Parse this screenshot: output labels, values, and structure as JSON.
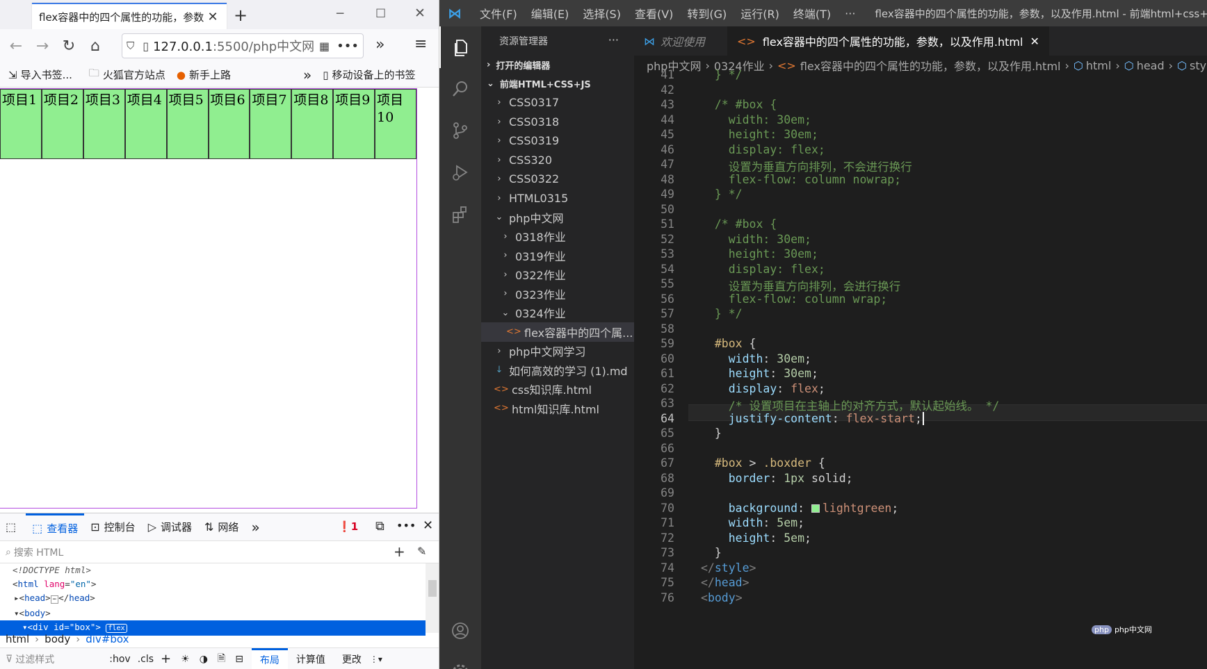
{
  "firefox": {
    "tab_title": "flex容器中的四个属性的功能，参数",
    "url_host": "127.0.0.1",
    "url_rest": ":5500/php中文网",
    "bookmarks": [
      "导入书签...",
      "火狐官方站点",
      "新手上路"
    ],
    "mobile_bookmarks": "移动设备上的书签",
    "items": [
      "项目1",
      "项目2",
      "项目3",
      "项目4",
      "项目5",
      "项目6",
      "项目7",
      "项目8",
      "项目9",
      "项目10"
    ],
    "devtools": {
      "tabs": [
        "查看器",
        "控制台",
        "调试器",
        "网络"
      ],
      "error_count": "1",
      "search_placeholder": "搜索 HTML",
      "tree": {
        "doctype": "<!DOCTYPE html>",
        "html_open": "html",
        "lang_attr": "lang",
        "lang_val": "\"en\"",
        "head": "head",
        "body": "body",
        "div_line": "<div id=\"box\">",
        "flex_badge": "flex"
      },
      "crumbs": [
        "html",
        "body",
        "div#box"
      ],
      "filter_placeholder": "过滤样式",
      "rules_tools": [
        ":hov",
        ".cls"
      ],
      "side_tabs": [
        "布局",
        "计算值",
        "更改"
      ]
    }
  },
  "vscode": {
    "menus": [
      "文件(F)",
      "编辑(E)",
      "选择(S)",
      "查看(V)",
      "转到(G)",
      "运行(R)",
      "终端(T)",
      "···"
    ],
    "window_title": "flex容器中的四个属性的功能，参数，以及作用.html - 前端html+css+js - Visu",
    "explorer_title": "资源管理器",
    "open_editors": "打开的编辑器",
    "workspace": "前端HTML+CSS+JS",
    "tree": [
      {
        "label": "CSS0317",
        "depth": 1,
        "chev": "›"
      },
      {
        "label": "CSS0318",
        "depth": 1,
        "chev": "›"
      },
      {
        "label": "CSS0319",
        "depth": 1,
        "chev": "›"
      },
      {
        "label": "CSS320",
        "depth": 1,
        "chev": "›"
      },
      {
        "label": "CSS0322",
        "depth": 1,
        "chev": "›"
      },
      {
        "label": "HTML0315",
        "depth": 1,
        "chev": "›"
      },
      {
        "label": "php中文网",
        "depth": 1,
        "chev": "⌄"
      },
      {
        "label": "0318作业",
        "depth": 2,
        "chev": "›"
      },
      {
        "label": "0319作业",
        "depth": 2,
        "chev": "›"
      },
      {
        "label": "0322作业",
        "depth": 2,
        "chev": "›"
      },
      {
        "label": "0323作业",
        "depth": 2,
        "chev": "›"
      },
      {
        "label": "0324作业",
        "depth": 2,
        "chev": "⌄"
      },
      {
        "label": "flex容器中的四个属...",
        "depth": 3,
        "chev": "<>"
      },
      {
        "label": "php中文网学习",
        "depth": 1,
        "chev": "›"
      },
      {
        "label": "如何高效的学习 (1).md",
        "depth": 1,
        "chev": "↓"
      },
      {
        "label": "css知识库.html",
        "depth": 1,
        "chev": "<>"
      },
      {
        "label": "html知识库.html",
        "depth": 1,
        "chev": "<>"
      }
    ],
    "tabs": [
      {
        "label": "欢迎使用",
        "active": false
      },
      {
        "label": "flex容器中的四个属性的功能，参数，以及作用.html",
        "active": true
      }
    ],
    "breadcrumb": [
      "php中文网",
      "0324作业",
      "flex容器中的四个属性的功能，参数，以及作用.html",
      "html",
      "head",
      "styl"
    ],
    "lines": [
      {
        "n": "41",
        "html": "  } */"
      },
      {
        "n": "42",
        "html": ""
      },
      {
        "n": "43",
        "html": "  /* #box {"
      },
      {
        "n": "44",
        "html": "    width: 30em;"
      },
      {
        "n": "45",
        "html": "    height: 30em;"
      },
      {
        "n": "46",
        "html": "    display: flex;"
      },
      {
        "n": "47",
        "html": "    设置为垂直方向排列，不会进行换行"
      },
      {
        "n": "48",
        "html": "    flex-flow: column nowrap;"
      },
      {
        "n": "49",
        "html": "  } */"
      },
      {
        "n": "50",
        "html": ""
      },
      {
        "n": "51",
        "html": "  /* #box {"
      },
      {
        "n": "52",
        "html": "    width: 30em;"
      },
      {
        "n": "53",
        "html": "    height: 30em;"
      },
      {
        "n": "54",
        "html": "    display: flex;"
      },
      {
        "n": "55",
        "html": "    设置为垂直方向排列，会进行换行"
      },
      {
        "n": "56",
        "html": "    flex-flow: column wrap;"
      },
      {
        "n": "57",
        "html": "  } */"
      },
      {
        "n": "58",
        "html": ""
      },
      {
        "n": "59",
        "html": "  #box {"
      },
      {
        "n": "60",
        "html": "    width: 30em;"
      },
      {
        "n": "61",
        "html": "    height: 30em;"
      },
      {
        "n": "62",
        "html": "    display: flex;"
      },
      {
        "n": "63",
        "html": "    /* 设置项目在主轴上的对齐方式，默认起始线。 */"
      },
      {
        "n": "64",
        "html": "    justify-content: flex-start;"
      },
      {
        "n": "65",
        "html": "  }"
      },
      {
        "n": "66",
        "html": ""
      },
      {
        "n": "67",
        "html": "  #box > .boxder {"
      },
      {
        "n": "68",
        "html": "    border: 1px solid;"
      },
      {
        "n": "69",
        "html": ""
      },
      {
        "n": "70",
        "html": "    background: lightgreen;"
      },
      {
        "n": "71",
        "html": "    width: 5em;"
      },
      {
        "n": "72",
        "html": "    height: 5em;"
      },
      {
        "n": "73",
        "html": "  }"
      },
      {
        "n": "74",
        "html": "</style>"
      },
      {
        "n": "75",
        "html": "</head>"
      },
      {
        "n": "76",
        "html": "<body>"
      }
    ],
    "watermark": "php中文网"
  }
}
